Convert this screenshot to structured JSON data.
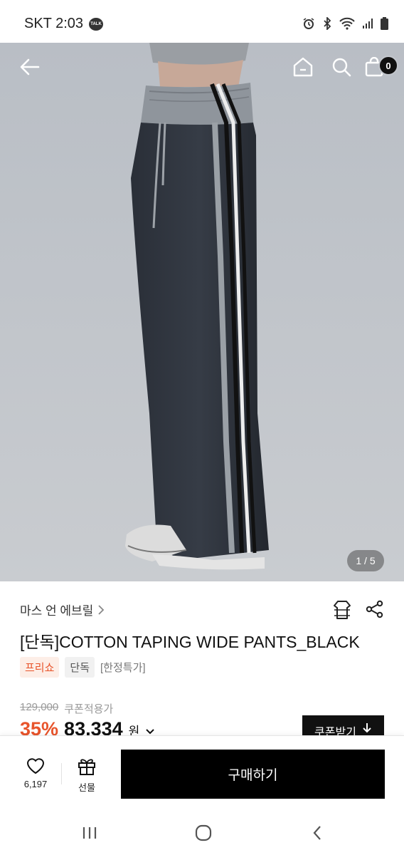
{
  "status": {
    "carrier_time": "SKT 2:03",
    "talk_badge": "TALK",
    "icons": [
      "alarm-icon",
      "bluetooth-icon",
      "wifi-icon",
      "signal-icon",
      "battery-icon"
    ]
  },
  "hero": {
    "pager": "1 / 5",
    "cart_count": "0",
    "background": "#c2c6cc"
  },
  "product": {
    "brand": "마스 언 에브릴",
    "title": "[단독]COTTON TAPING WIDE PANTS_BLACK",
    "tags": {
      "free": "프리쇼",
      "exclusive": "단독",
      "limited": "[한정특가]"
    },
    "original_price": "129,000",
    "coupon_price_label": "쿠폰적용가",
    "discount": "35%",
    "price": "83,334",
    "currency": "원",
    "coupon_button": "쿠폰받기"
  },
  "actions": {
    "like_count": "6,197",
    "gift_label": "선물",
    "buy_label": "구매하기"
  },
  "colors": {
    "accent": "#e8542b",
    "primary": "#000000"
  }
}
